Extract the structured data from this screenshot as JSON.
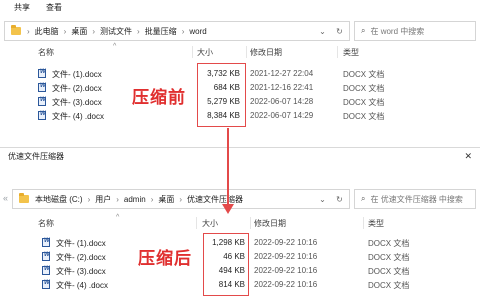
{
  "window1": {
    "ribbon": [
      "共享",
      "查看"
    ],
    "breadcrumb": [
      "此电脑",
      "桌面",
      "测试文件",
      "批量压缩",
      "word"
    ],
    "search_placeholder": "在 word 中搜索",
    "columns": {
      "name": "名称",
      "size": "大小",
      "date": "修改日期",
      "type": "类型"
    },
    "files": [
      {
        "name": "文件- (1).docx",
        "size": "3,732 KB",
        "date": "2021-12-27 22:04",
        "type": "DOCX 文档"
      },
      {
        "name": "文件- (2).docx",
        "size": "684 KB",
        "date": "2021-12-16 22:41",
        "type": "DOCX 文档"
      },
      {
        "name": "文件- (3).docx",
        "size": "5,279 KB",
        "date": "2022-06-07 14:28",
        "type": "DOCX 文档"
      },
      {
        "name": "文件- (4) .docx",
        "size": "8,384 KB",
        "date": "2022-06-07 14:29",
        "type": "DOCX 文档"
      }
    ],
    "annotation": "压缩前"
  },
  "window2": {
    "title": "优速文件压缩器",
    "close": "✕",
    "breadcrumb": [
      "本地磁盘 (C:)",
      "用户",
      "admin",
      "桌面",
      "优速文件压缩器"
    ],
    "search_placeholder": "在 优速文件压缩器 中搜索",
    "columns": {
      "name": "名称",
      "size": "大小",
      "date": "修改日期",
      "type": "类型"
    },
    "files": [
      {
        "name": "文件- (1).docx",
        "size": "1,298 KB",
        "date": "2022-09-22 10:16",
        "type": "DOCX 文档"
      },
      {
        "name": "文件- (2).docx",
        "size": "46 KB",
        "date": "2022-09-22 10:16",
        "type": "DOCX 文档"
      },
      {
        "name": "文件- (3).docx",
        "size": "494 KB",
        "date": "2022-09-22 10:16",
        "type": "DOCX 文档"
      },
      {
        "name": "文件- (4) .docx",
        "size": "814 KB",
        "date": "2022-09-22 10:16",
        "type": "DOCX 文档"
      }
    ],
    "annotation": "压缩后"
  },
  "colors": {
    "annotation_red": "#e34a4a",
    "folder": "#f3c34b",
    "docx_blue": "#2b579a"
  },
  "icons": {
    "back": "arrow-left-icon",
    "forward": "arrow-right-icon",
    "up": "arrow-up-icon",
    "refresh": "refresh-icon",
    "search": "search-icon",
    "dropdown": "chevron-down-icon"
  }
}
